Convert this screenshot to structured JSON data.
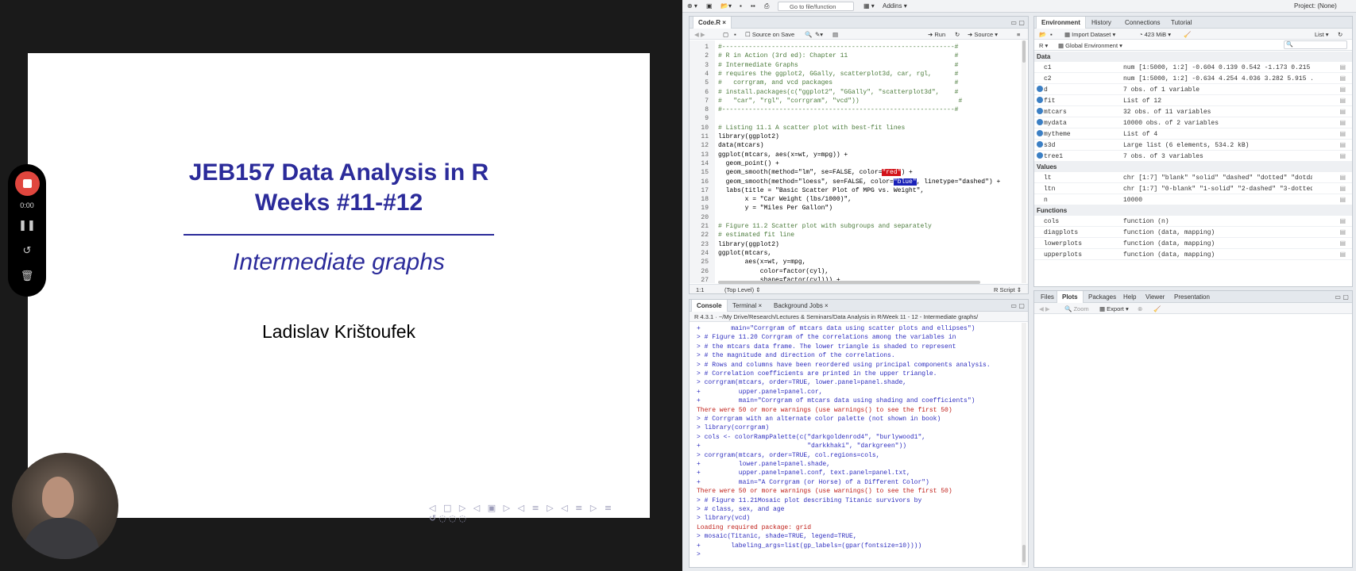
{
  "slide": {
    "title_line1": "JEB157 Data Analysis in R",
    "title_line2": "Weeks #11-#12",
    "subtitle": "Intermediate graphs",
    "author": "Ladislav Krištoufek",
    "nav": "◁ □ ▷ ◁ ▣ ▷ ◁ ≡ ▷ ◁ ≡ ▷ ≡ ↺◌◌◌"
  },
  "recorder": {
    "time": "0:00"
  },
  "topbar": {
    "goto_placeholder": "Go to file/function",
    "addins": "Addins",
    "project": "Project: (None)"
  },
  "editor": {
    "tab": "Code.R",
    "source_on_save": "Source on Save",
    "run": "Run",
    "source": "Source",
    "status_pos": "1:1",
    "status_scope": "(Top Level)",
    "status_type": "R Script",
    "lines": [
      "#-------------------------------------------------------------#",
      "# R in Action (3rd ed): Chapter 11                            #",
      "# Intermediate Graphs                                         #",
      "# requires the ggplot2, GGally, scatterplot3d, car, rgl,      #",
      "#   corrgram, and vcd packages                                #",
      "# install.packages(c(\"ggplot2\", \"GGally\", \"scatterplot3d\",    #",
      "#   \"car\", \"rgl\", \"corrgram\", \"vcd\"))                          #",
      "#-------------------------------------------------------------#",
      "",
      "# Listing 11.1 A scatter plot with best-fit lines",
      "library(ggplot2)",
      "data(mtcars)",
      "ggplot(mtcars, aes(x=wt, y=mpg)) +",
      "  geom_point() +",
      "  geom_smooth(method=\"lm\", se=FALSE, color=\"red\") +",
      "  geom_smooth(method=\"loess\", se=FALSE, color=\"blue\", linetype=\"dashed\") +",
      "  labs(title = \"Basic Scatter Plot of MPG vs. Weight\",",
      "       x = \"Car Weight (lbs/1000)\",",
      "       y = \"Miles Per Gallon\")",
      "",
      "# Figure 11.2 Scatter plot with subgroups and separately",
      "# estimated fit line",
      "library(ggplot2)",
      "ggplot(mtcars,",
      "       aes(x=wt, y=mpg,",
      "           color=factor(cyl),",
      "           shape=factor(cyl))) +"
    ]
  },
  "console": {
    "tabs": [
      "Console",
      "Terminal",
      "Background Jobs"
    ],
    "path": "R 4.3.1 · ~/My Drive/Research/Lectures & Seminars/Data Analysis in R/Week 11 - 12 - Intermediate graphs/",
    "lines": [
      {
        "t": "+        main=\"Corrgram of mtcars data using scatter plots and ellipses\")",
        "k": "p"
      },
      {
        "t": "> # Figure 11.20 Corrgram of the correlations among the variables in",
        "k": "p"
      },
      {
        "t": "> # the mtcars data frame. The lower triangle is shaded to represent",
        "k": "p"
      },
      {
        "t": "> # the magnitude and direction of the correlations.",
        "k": "p"
      },
      {
        "t": "> # Rows and columns have been reordered using principal components analysis.",
        "k": "p"
      },
      {
        "t": "> # Correlation coefficients are printed in the upper triangle.",
        "k": "p"
      },
      {
        "t": "> corrgram(mtcars, order=TRUE, lower.panel=panel.shade,",
        "k": "p"
      },
      {
        "t": "+          upper.panel=panel.cor,",
        "k": "p"
      },
      {
        "t": "+          main=\"Corrgram of mtcars data using shading and coefficients\")",
        "k": "p"
      },
      {
        "t": "There were 50 or more warnings (use warnings() to see the first 50)",
        "k": "w"
      },
      {
        "t": "> # Corrgram with an alternate color palette (not shown in book)",
        "k": "p"
      },
      {
        "t": "> library(corrgram)",
        "k": "p"
      },
      {
        "t": "> cols <- colorRampPalette(c(\"darkgoldenrod4\", \"burlywood1\",",
        "k": "p"
      },
      {
        "t": "+                            \"darkkhaki\", \"darkgreen\"))",
        "k": "p"
      },
      {
        "t": "> corrgram(mtcars, order=TRUE, col.regions=cols,",
        "k": "p"
      },
      {
        "t": "+          lower.panel=panel.shade,",
        "k": "p"
      },
      {
        "t": "+          upper.panel=panel.conf, text.panel=panel.txt,",
        "k": "p"
      },
      {
        "t": "+          main=\"A Corrgram (or Horse) of a Different Color\")",
        "k": "p"
      },
      {
        "t": "There were 50 or more warnings (use warnings() to see the first 50)",
        "k": "w"
      },
      {
        "t": "> # Figure 11.21Mosaic plot describing Titanic survivors by",
        "k": "p"
      },
      {
        "t": "> # class, sex, and age",
        "k": "p"
      },
      {
        "t": "> library(vcd)",
        "k": "p"
      },
      {
        "t": "Loading required package: grid",
        "k": "w"
      },
      {
        "t": "> mosaic(Titanic, shade=TRUE, legend=TRUE,",
        "k": "p"
      },
      {
        "t": "+        labeling_args=list(gp_labels=(gpar(fontsize=10))))",
        "k": "p"
      },
      {
        "t": ">",
        "k": "p"
      }
    ]
  },
  "environment": {
    "tabs": [
      "Environment",
      "History",
      "Connections",
      "Tutorial"
    ],
    "import": "Import Dataset",
    "memory": "423 MiB",
    "list": "List",
    "lang": "R",
    "scope": "Global Environment",
    "sections": {
      "data": "Data",
      "values": "Values",
      "functions": "Functions"
    },
    "data_rows": [
      {
        "name": "c1",
        "value": "num [1:5000, 1:2] -0.604 0.139 0.542 -1.173 0.215 ..."
      },
      {
        "name": "c2",
        "value": "num [1:5000, 1:2] -0.634 4.254 4.036 3.282 5.915 ..."
      },
      {
        "name": "d",
        "value": "7 obs. of 1 variable"
      },
      {
        "name": "fit",
        "value": "List of  12"
      },
      {
        "name": "mtcars",
        "value": "32 obs. of 11 variables"
      },
      {
        "name": "mydata",
        "value": "10000 obs. of 2 variables"
      },
      {
        "name": "mytheme",
        "value": "List of  4"
      },
      {
        "name": "s3d",
        "value": "Large list (6 elements,  534.2 kB)"
      },
      {
        "name": "tree1",
        "value": "7 obs. of 3 variables"
      }
    ],
    "value_rows": [
      {
        "name": "lt",
        "value": "chr [1:7] \"blank\" \"solid\" \"dashed\" \"dotted\" \"dotdash\" \"..."
      },
      {
        "name": "ltn",
        "value": "chr [1:7] \"0-blank\" \"1-solid\" \"2-dashed\" \"3-dotted\" \"4-..."
      },
      {
        "name": "n",
        "value": "10000"
      }
    ],
    "function_rows": [
      {
        "name": "cols",
        "value": "function (n)"
      },
      {
        "name": "diagplots",
        "value": "function (data, mapping)"
      },
      {
        "name": "lowerplots",
        "value": "function (data, mapping)"
      },
      {
        "name": "upperplots",
        "value": "function (data, mapping)"
      }
    ]
  },
  "files": {
    "tabs": [
      "Files",
      "Plots",
      "Packages",
      "Help",
      "Viewer",
      "Presentation"
    ],
    "zoom": "Zoom",
    "export": "Export"
  }
}
